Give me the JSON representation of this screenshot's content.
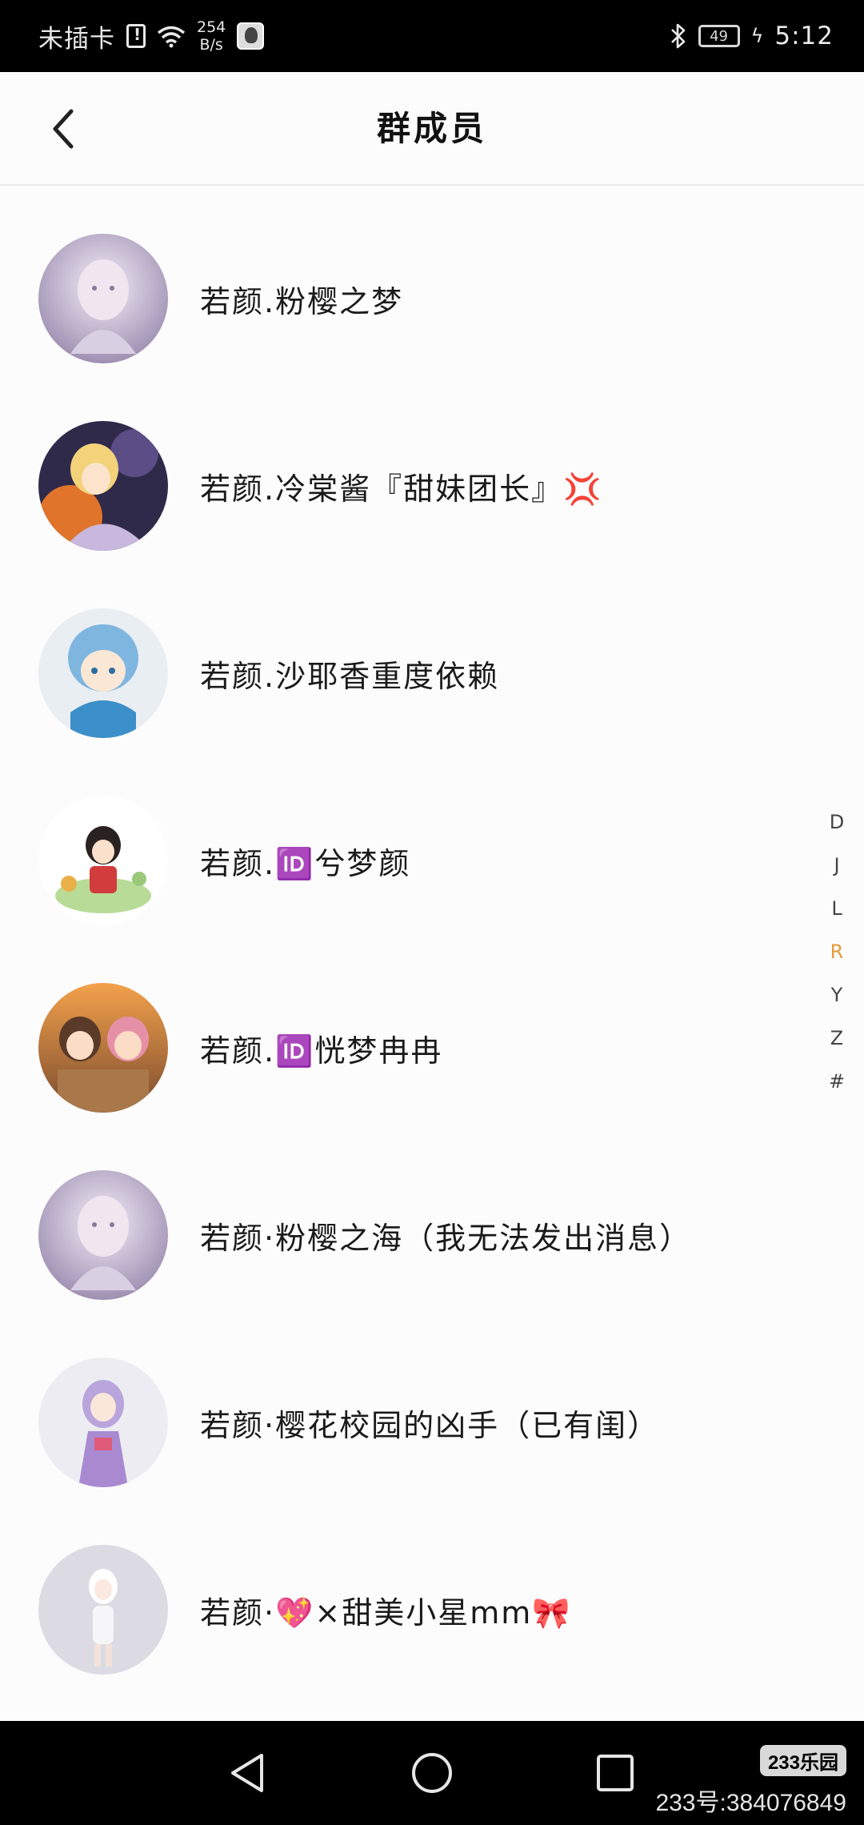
{
  "status_bar": {
    "carrier": "未插卡",
    "net_speed_value": "254",
    "net_speed_unit": "B/s",
    "battery": "49",
    "time": "5:12"
  },
  "header": {
    "title": "群成员",
    "back_icon": "chevron-left-icon"
  },
  "members": [
    {
      "name": "若颜.粉樱之梦",
      "avatar_color": "#c9bcd6"
    },
    {
      "name": "若颜.冷棠酱『甜妹团长』💢",
      "avatar_color": "#d98a3a"
    },
    {
      "name": "若颜.沙耶香重度依赖",
      "avatar_color": "#7fb2d8"
    },
    {
      "name": "若颜.🆔兮梦颜",
      "avatar_color": "#bfe0a6"
    },
    {
      "name": "若颜.🆔恍梦冉冉",
      "avatar_color": "#c98a5a"
    },
    {
      "name": "若颜·粉樱之海（我无法发出消息）",
      "avatar_color": "#c9bcd6"
    },
    {
      "name": "若颜·樱花校园的凶手（已有闺）",
      "avatar_color": "#d8c8e8"
    },
    {
      "name": "若颜·💖×甜美小星mm🎀",
      "avatar_color": "#d6d4e0"
    }
  ],
  "index_bar": {
    "letters": [
      "D",
      "J",
      "L",
      "R",
      "Y",
      "Z",
      "#"
    ],
    "active": "R",
    "active_color": "#e59a3a"
  },
  "nav_bar": {
    "back_icon": "triangle-back-icon",
    "home_icon": "circle-home-icon",
    "recents_icon": "square-recents-icon"
  },
  "watermark": {
    "logo": "233乐园",
    "id_text": "233号:384076849"
  }
}
